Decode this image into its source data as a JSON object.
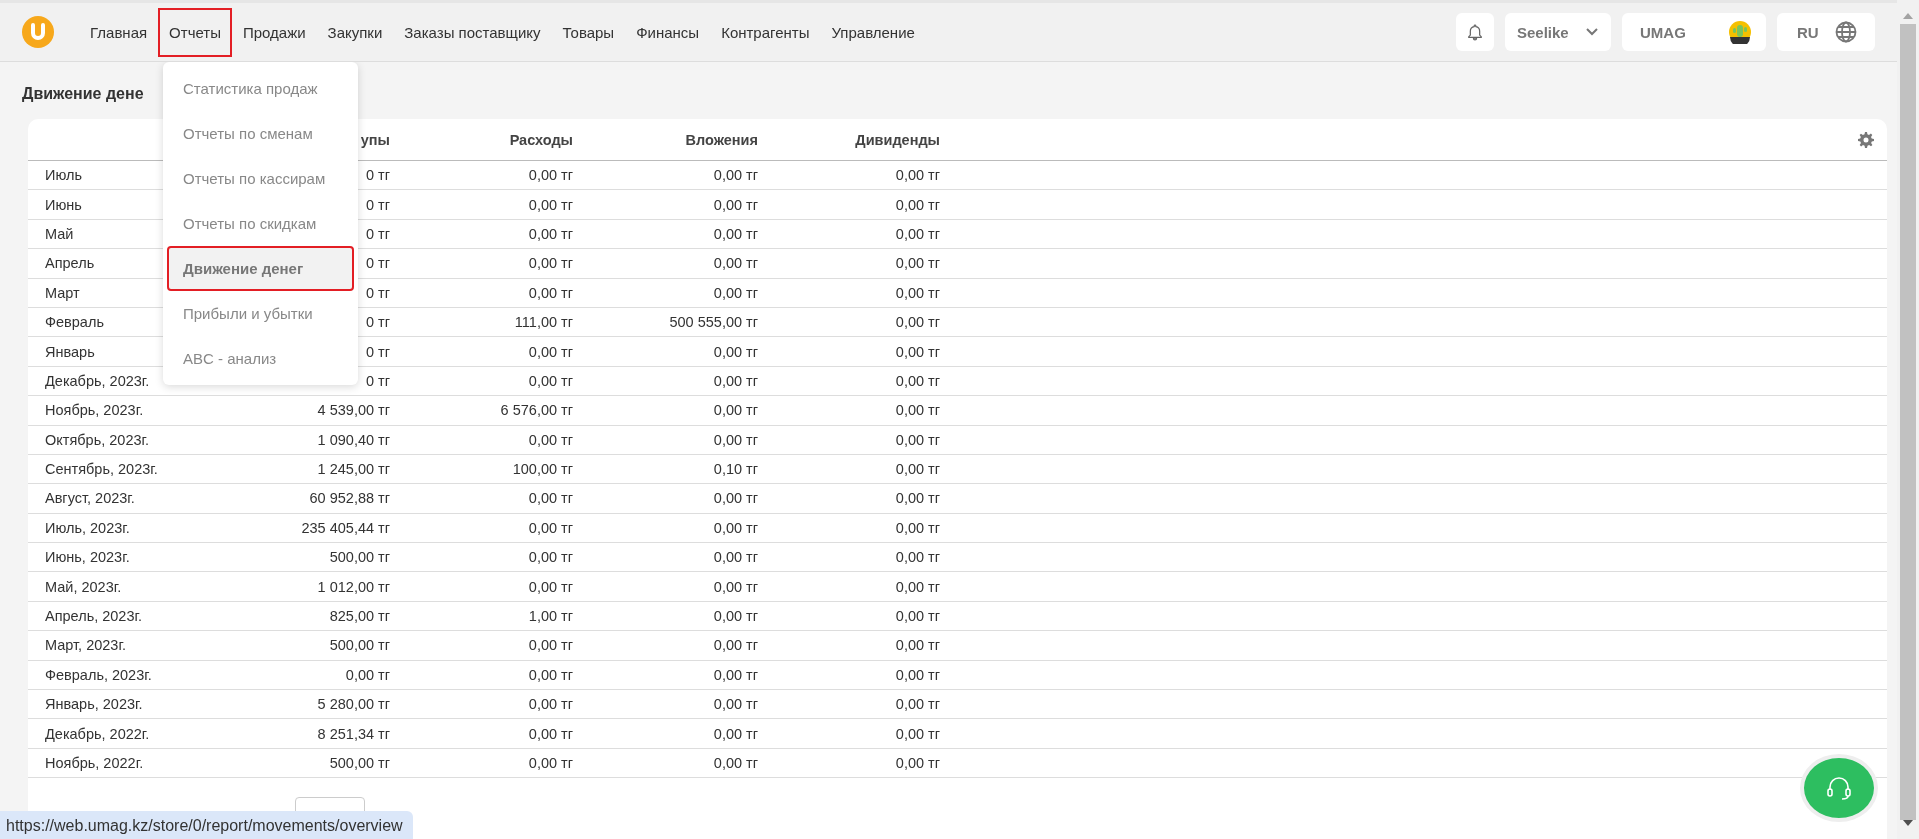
{
  "nav": {
    "items": [
      {
        "label": "Главная",
        "selected": false
      },
      {
        "label": "Отчеты",
        "selected": true
      },
      {
        "label": "Продажи",
        "selected": false
      },
      {
        "label": "Закупки",
        "selected": false
      },
      {
        "label": "Заказы поставщику",
        "selected": false
      },
      {
        "label": "Товары",
        "selected": false
      },
      {
        "label": "Финансы",
        "selected": false
      },
      {
        "label": "Контрагенты",
        "selected": false
      },
      {
        "label": "Управление",
        "selected": false
      }
    ]
  },
  "header_right": {
    "store": "Seelike",
    "account": "UMAG",
    "language": "RU"
  },
  "page_title": "Движение дене",
  "menu": {
    "items": [
      {
        "label": "Статистика продаж",
        "selected": false
      },
      {
        "label": "Отчеты по сменам",
        "selected": false
      },
      {
        "label": "Отчеты по кассирам",
        "selected": false
      },
      {
        "label": "Отчеты по скидкам",
        "selected": false
      },
      {
        "label": "Движение денег",
        "selected": true
      },
      {
        "label": "Прибыли и убытки",
        "selected": false
      },
      {
        "label": "ABC - анализ",
        "selected": false
      }
    ]
  },
  "table": {
    "columns": [
      "",
      "упы",
      "Расходы",
      "Вложения",
      "Дивиденды"
    ],
    "rows": [
      [
        "Июль",
        "0 тг",
        "0,00 тг",
        "0,00 тг",
        "0,00 тг"
      ],
      [
        "Июнь",
        "0 тг",
        "0,00 тг",
        "0,00 тг",
        "0,00 тг"
      ],
      [
        "Май",
        "0 тг",
        "0,00 тг",
        "0,00 тг",
        "0,00 тг"
      ],
      [
        "Апрель",
        "0 тг",
        "0,00 тг",
        "0,00 тг",
        "0,00 тг"
      ],
      [
        "Март",
        "0 тг",
        "0,00 тг",
        "0,00 тг",
        "0,00 тг"
      ],
      [
        "Февраль",
        "0 тг",
        "111,00 тг",
        "500 555,00 тг",
        "0,00 тг"
      ],
      [
        "Январь",
        "0 тг",
        "0,00 тг",
        "0,00 тг",
        "0,00 тг"
      ],
      [
        "Декабрь, 2023г.",
        "0 тг",
        "0,00 тг",
        "0,00 тг",
        "0,00 тг"
      ],
      [
        "Ноябрь, 2023г.",
        "4 539,00 тг",
        "6 576,00 тг",
        "0,00 тг",
        "0,00 тг"
      ],
      [
        "Октябрь, 2023г.",
        "1 090,40 тг",
        "0,00 тг",
        "0,00 тг",
        "0,00 тг"
      ],
      [
        "Сентябрь, 2023г.",
        "1 245,00 тг",
        "100,00 тг",
        "0,10 тг",
        "0,00 тг"
      ],
      [
        "Август, 2023г.",
        "60 952,88 тг",
        "0,00 тг",
        "0,00 тг",
        "0,00 тг"
      ],
      [
        "Июль, 2023г.",
        "235 405,44 тг",
        "0,00 тг",
        "0,00 тг",
        "0,00 тг"
      ],
      [
        "Июнь, 2023г.",
        "500,00 тг",
        "0,00 тг",
        "0,00 тг",
        "0,00 тг"
      ],
      [
        "Май, 2023г.",
        "1 012,00 тг",
        "0,00 тг",
        "0,00 тг",
        "0,00 тг"
      ],
      [
        "Апрель, 2023г.",
        "825,00 тг",
        "1,00 тг",
        "0,00 тг",
        "0,00 тг"
      ],
      [
        "Март, 2023г.",
        "500,00 тг",
        "0,00 тг",
        "0,00 тг",
        "0,00 тг"
      ],
      [
        "Февраль, 2023г.",
        "0,00 тг",
        "0,00 тг",
        "0,00 тг",
        "0,00 тг"
      ],
      [
        "Январь, 2023г.",
        "5 280,00 тг",
        "0,00 тг",
        "0,00 тг",
        "0,00 тг"
      ],
      [
        "Декабрь, 2022г.",
        "8 251,34 тг",
        "0,00 тг",
        "0,00 тг",
        "0,00 тг"
      ],
      [
        "Ноябрь, 2022г.",
        "500,00 тг",
        "0,00 тг",
        "0,00 тг",
        "0,00 тг"
      ]
    ]
  },
  "status_url": "https://web.umag.kz/store/0/report/movements/overview"
}
